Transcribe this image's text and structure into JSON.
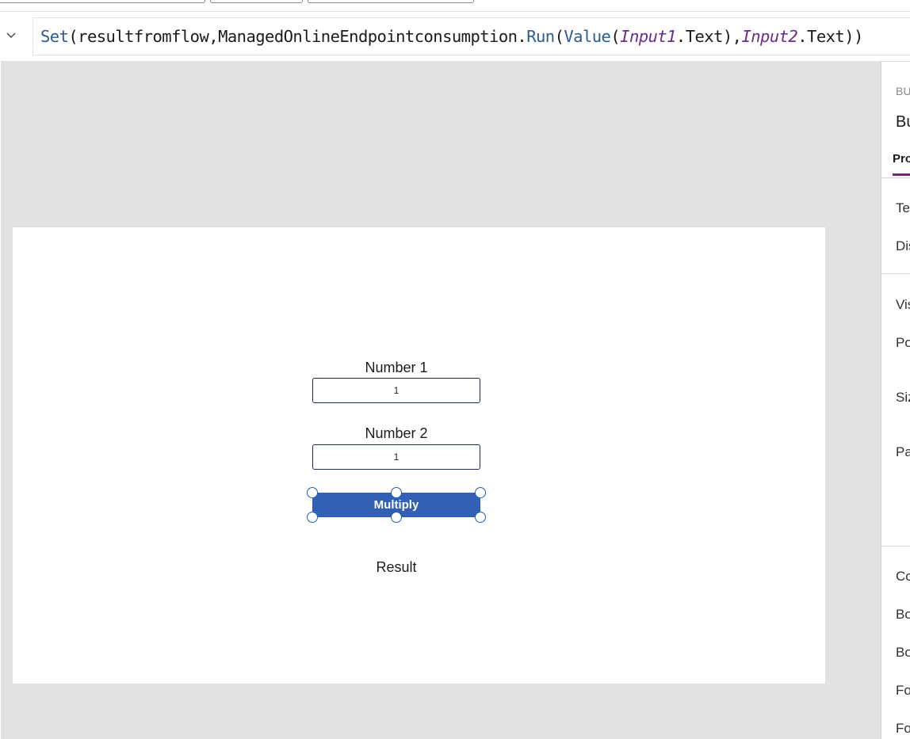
{
  "formula_bar": {
    "tokens": [
      {
        "text": "Set",
        "kind": "fn"
      },
      {
        "text": "(resultfromflow,ManagedOnlineEndpointconsumption.",
        "kind": "plain"
      },
      {
        "text": "Run",
        "kind": "fn"
      },
      {
        "text": "(",
        "kind": "plain"
      },
      {
        "text": "Value",
        "kind": "fn"
      },
      {
        "text": "(",
        "kind": "plain"
      },
      {
        "text": "Input1",
        "kind": "var"
      },
      {
        "text": ".Text),",
        "kind": "plain"
      },
      {
        "text": "Input2",
        "kind": "var"
      },
      {
        "text": ".Text))",
        "kind": "plain"
      }
    ],
    "colors": {
      "fn": "#2a5c91",
      "var": "#6b2c8a",
      "plain": "#1b1b1b"
    }
  },
  "app_screen": {
    "number1_label": "Number 1",
    "number1_value": "1",
    "number2_label": "Number 2",
    "number2_value": "1",
    "button_label": "Multiply",
    "result_label": "Result"
  },
  "properties_panel": {
    "type_label": "BU",
    "name": "Bu",
    "tab": "Pro",
    "rows": [
      "Tex",
      "Dis",
      "Vis",
      "Po",
      "Siz",
      "Pa",
      "Co",
      "Bo",
      "Bo",
      "Fo",
      "Fo"
    ]
  },
  "colors": {
    "button": "#3160b5",
    "canvas_bg": "#e2e2e2",
    "selection": "#1e5fb3",
    "tab_accent": "#742774"
  }
}
